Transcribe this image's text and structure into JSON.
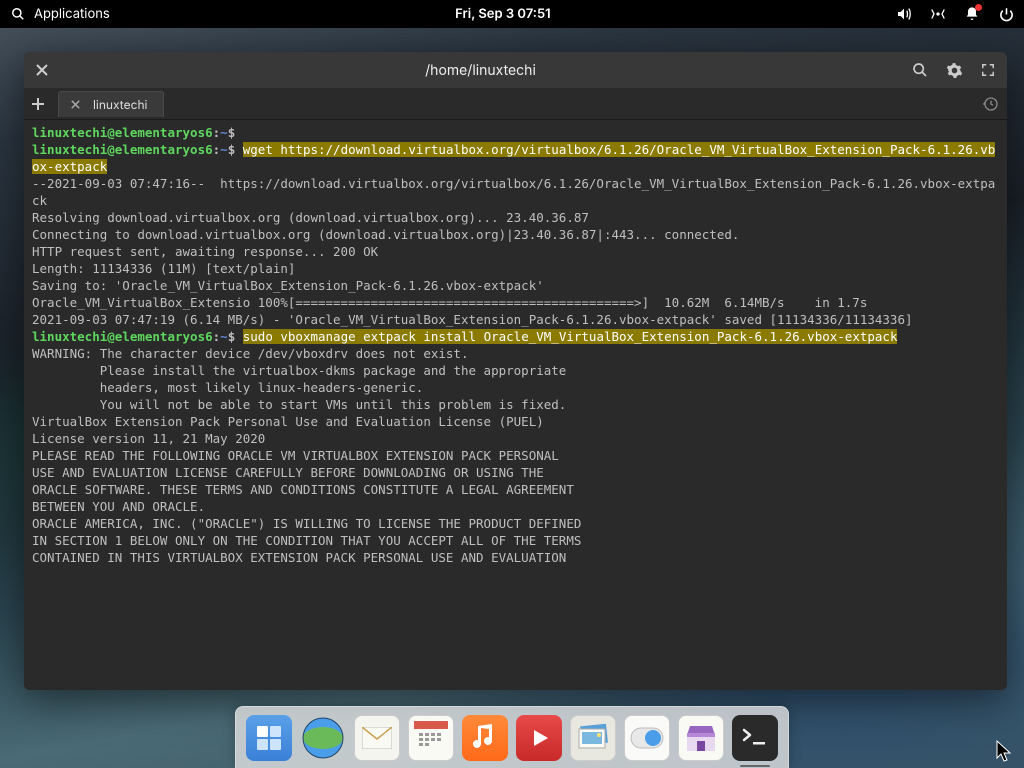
{
  "topbar": {
    "applications": "Applications",
    "datetime": "Fri, Sep  3   07:51"
  },
  "window": {
    "title": "/home/linuxtechi",
    "tab_label": "linuxtechi"
  },
  "prompt": {
    "user_host": "linuxtechi@elementaryos6",
    "sep": ":",
    "path": "~",
    "sigil": "$"
  },
  "cmd1": "wget https://download.virtualbox.org/virtualbox/6.1.26/Oracle_VM_VirtualBox_Extension_Pack-6.1.26.vbox-extpack",
  "out1": [
    "--2021-09-03 07:47:16--  https://download.virtualbox.org/virtualbox/6.1.26/Oracle_VM_VirtualBox_Extension_Pack-6.1.26.vbox-extpack",
    "Resolving download.virtualbox.org (download.virtualbox.org)... 23.40.36.87",
    "Connecting to download.virtualbox.org (download.virtualbox.org)|23.40.36.87|:443... connected.",
    "HTTP request sent, awaiting response... 200 OK",
    "Length: 11134336 (11M) [text/plain]",
    "Saving to: 'Oracle_VM_VirtualBox_Extension_Pack-6.1.26.vbox-extpack'",
    "",
    "Oracle_VM_VirtualBox_Extensio 100%[=============================================>]  10.62M  6.14MB/s    in 1.7s",
    "",
    "2021-09-03 07:47:19 (6.14 MB/s) - 'Oracle_VM_VirtualBox_Extension_Pack-6.1.26.vbox-extpack' saved [11134336/11134336]",
    ""
  ],
  "cmd2": "sudo vboxmanage extpack install Oracle_VM_VirtualBox_Extension_Pack-6.1.26.vbox-extpack",
  "out2": [
    "WARNING: The character device /dev/vboxdrv does not exist.",
    "         Please install the virtualbox-dkms package and the appropriate",
    "         headers, most likely linux-headers-generic.",
    "",
    "         You will not be able to start VMs until this problem is fixed.",
    "VirtualBox Extension Pack Personal Use and Evaluation License (PUEL)",
    "",
    "License version 11, 21 May 2020",
    "",
    "PLEASE READ THE FOLLOWING ORACLE VM VIRTUALBOX EXTENSION PACK PERSONAL",
    "USE AND EVALUATION LICENSE CAREFULLY BEFORE DOWNLOADING OR USING THE",
    "ORACLE SOFTWARE. THESE TERMS AND CONDITIONS CONSTITUTE A LEGAL AGREEMENT",
    "BETWEEN YOU AND ORACLE.",
    "",
    "ORACLE AMERICA, INC. (\"ORACLE\") IS WILLING TO LICENSE THE PRODUCT DEFINED",
    "IN SECTION 1 BELOW ONLY ON THE CONDITION THAT YOU ACCEPT ALL OF THE TERMS",
    "CONTAINED IN THIS VIRTUALBOX EXTENSION PACK PERSONAL USE AND EVALUATION"
  ],
  "dock": {
    "items": [
      "multitask",
      "web",
      "mail",
      "calendar",
      "music",
      "video",
      "photos",
      "settings",
      "store",
      "terminal"
    ]
  }
}
